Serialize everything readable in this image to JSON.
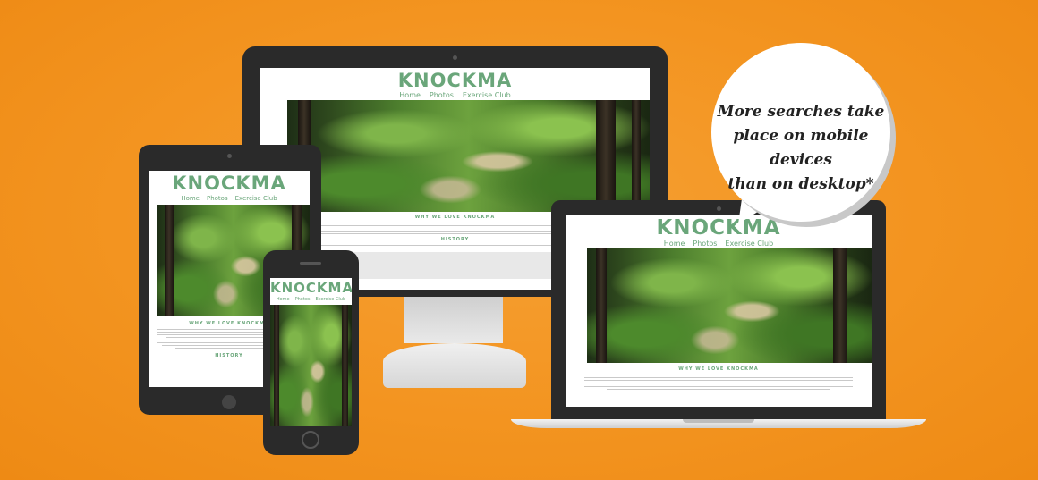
{
  "site": {
    "logo": "KNOCKMA",
    "nav": [
      "Home",
      "Photos",
      "Exercise Club"
    ],
    "section_why": "WHY WE LOVE KNOCKMA",
    "section_history": "HISTORY"
  },
  "bubble": {
    "lines": [
      "More searches take",
      "place on mobile devices",
      "than on desktop*"
    ]
  },
  "colors": {
    "background": "#f39420",
    "brand_green": "#6aa67a",
    "device": "#2a2a2a"
  }
}
